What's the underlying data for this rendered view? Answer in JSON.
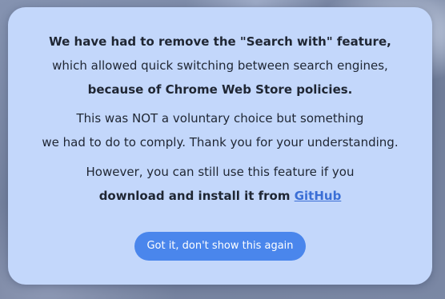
{
  "notice": {
    "paragraph1": {
      "line1": "We have had to remove the \"Search with\" feature,",
      "line2": "which allowed quick switching between search engines,",
      "line3": "because of Chrome Web Store policies."
    },
    "paragraph2": {
      "line1": "This was NOT a voluntary choice but something",
      "line2": "we had to do to comply. Thank you for your understanding."
    },
    "paragraph3": {
      "line1": "However, you can still use this feature if you",
      "line2_prefix": "download and install it from ",
      "link_label": "GitHub"
    },
    "button_label": "Got it, don't show this again"
  },
  "colors": {
    "card_background": "#c3d7fb",
    "button_background": "#4a86ec",
    "link": "#3b6fd6",
    "text": "#1f2633"
  }
}
